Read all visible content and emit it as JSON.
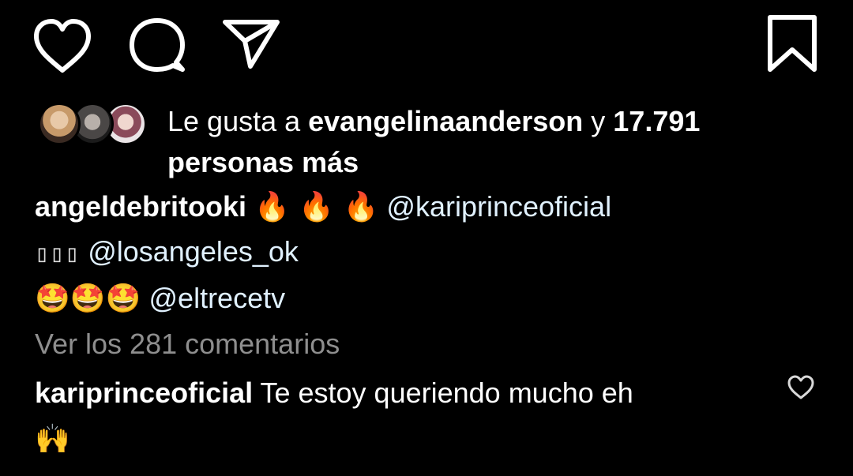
{
  "actions": {
    "like_icon": "heart-icon",
    "comment_icon": "comment-icon",
    "share_icon": "paper-plane-icon",
    "save_icon": "bookmark-icon"
  },
  "likes": {
    "prefix": "Le gusta a ",
    "user": "evangelinaanderson",
    "connector": " y ",
    "count": "17.791",
    "suffix": "personas más"
  },
  "caption": {
    "username": "angeldebritooki",
    "emoji_fire": "🔥 🔥 🔥",
    "mention1": "@kariprinceoficial",
    "boxes": "▯▯▯",
    "mention2": "@losangeles_ok",
    "emoji_star": "🤩🤩🤩",
    "mention3": "@eltrecetv"
  },
  "view_comments": "Ver los 281 comentarios",
  "comment": {
    "username": "kariprinceoficial",
    "text": "Te estoy queriendo mucho eh",
    "emoji": "🙌"
  },
  "colors": {
    "background": "#000000",
    "text": "#ffffff",
    "muted": "#8e8e8e",
    "mention": "#e0f1ff"
  }
}
